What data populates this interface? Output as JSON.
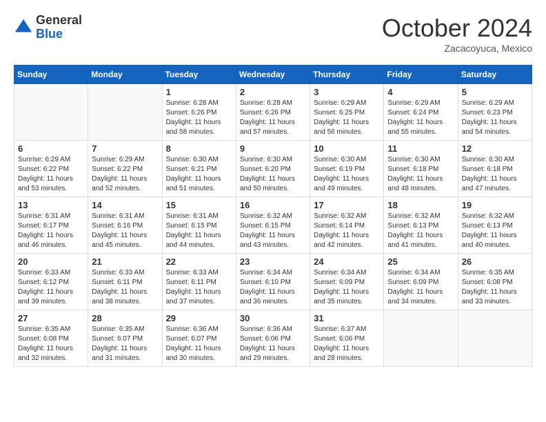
{
  "header": {
    "logo_general": "General",
    "logo_blue": "Blue",
    "month": "October 2024",
    "location": "Zacacoyuca, Mexico"
  },
  "weekdays": [
    "Sunday",
    "Monday",
    "Tuesday",
    "Wednesday",
    "Thursday",
    "Friday",
    "Saturday"
  ],
  "weeks": [
    [
      {
        "day": "",
        "sunrise": "",
        "sunset": "",
        "daylight": ""
      },
      {
        "day": "",
        "sunrise": "",
        "sunset": "",
        "daylight": ""
      },
      {
        "day": "1",
        "sunrise": "Sunrise: 6:28 AM",
        "sunset": "Sunset: 6:26 PM",
        "daylight": "Daylight: 11 hours and 58 minutes."
      },
      {
        "day": "2",
        "sunrise": "Sunrise: 6:28 AM",
        "sunset": "Sunset: 6:26 PM",
        "daylight": "Daylight: 11 hours and 57 minutes."
      },
      {
        "day": "3",
        "sunrise": "Sunrise: 6:29 AM",
        "sunset": "Sunset: 6:25 PM",
        "daylight": "Daylight: 11 hours and 56 minutes."
      },
      {
        "day": "4",
        "sunrise": "Sunrise: 6:29 AM",
        "sunset": "Sunset: 6:24 PM",
        "daylight": "Daylight: 11 hours and 55 minutes."
      },
      {
        "day": "5",
        "sunrise": "Sunrise: 6:29 AM",
        "sunset": "Sunset: 6:23 PM",
        "daylight": "Daylight: 11 hours and 54 minutes."
      }
    ],
    [
      {
        "day": "6",
        "sunrise": "Sunrise: 6:29 AM",
        "sunset": "Sunset: 6:22 PM",
        "daylight": "Daylight: 11 hours and 53 minutes."
      },
      {
        "day": "7",
        "sunrise": "Sunrise: 6:29 AM",
        "sunset": "Sunset: 6:22 PM",
        "daylight": "Daylight: 11 hours and 52 minutes."
      },
      {
        "day": "8",
        "sunrise": "Sunrise: 6:30 AM",
        "sunset": "Sunset: 6:21 PM",
        "daylight": "Daylight: 11 hours and 51 minutes."
      },
      {
        "day": "9",
        "sunrise": "Sunrise: 6:30 AM",
        "sunset": "Sunset: 6:20 PM",
        "daylight": "Daylight: 11 hours and 50 minutes."
      },
      {
        "day": "10",
        "sunrise": "Sunrise: 6:30 AM",
        "sunset": "Sunset: 6:19 PM",
        "daylight": "Daylight: 11 hours and 49 minutes."
      },
      {
        "day": "11",
        "sunrise": "Sunrise: 6:30 AM",
        "sunset": "Sunset: 6:18 PM",
        "daylight": "Daylight: 11 hours and 48 minutes."
      },
      {
        "day": "12",
        "sunrise": "Sunrise: 6:30 AM",
        "sunset": "Sunset: 6:18 PM",
        "daylight": "Daylight: 11 hours and 47 minutes."
      }
    ],
    [
      {
        "day": "13",
        "sunrise": "Sunrise: 6:31 AM",
        "sunset": "Sunset: 6:17 PM",
        "daylight": "Daylight: 11 hours and 46 minutes."
      },
      {
        "day": "14",
        "sunrise": "Sunrise: 6:31 AM",
        "sunset": "Sunset: 6:16 PM",
        "daylight": "Daylight: 11 hours and 45 minutes."
      },
      {
        "day": "15",
        "sunrise": "Sunrise: 6:31 AM",
        "sunset": "Sunset: 6:15 PM",
        "daylight": "Daylight: 11 hours and 44 minutes."
      },
      {
        "day": "16",
        "sunrise": "Sunrise: 6:32 AM",
        "sunset": "Sunset: 6:15 PM",
        "daylight": "Daylight: 11 hours and 43 minutes."
      },
      {
        "day": "17",
        "sunrise": "Sunrise: 6:32 AM",
        "sunset": "Sunset: 6:14 PM",
        "daylight": "Daylight: 11 hours and 42 minutes."
      },
      {
        "day": "18",
        "sunrise": "Sunrise: 6:32 AM",
        "sunset": "Sunset: 6:13 PM",
        "daylight": "Daylight: 11 hours and 41 minutes."
      },
      {
        "day": "19",
        "sunrise": "Sunrise: 6:32 AM",
        "sunset": "Sunset: 6:13 PM",
        "daylight": "Daylight: 11 hours and 40 minutes."
      }
    ],
    [
      {
        "day": "20",
        "sunrise": "Sunrise: 6:33 AM",
        "sunset": "Sunset: 6:12 PM",
        "daylight": "Daylight: 11 hours and 39 minutes."
      },
      {
        "day": "21",
        "sunrise": "Sunrise: 6:33 AM",
        "sunset": "Sunset: 6:11 PM",
        "daylight": "Daylight: 11 hours and 38 minutes."
      },
      {
        "day": "22",
        "sunrise": "Sunrise: 6:33 AM",
        "sunset": "Sunset: 6:11 PM",
        "daylight": "Daylight: 11 hours and 37 minutes."
      },
      {
        "day": "23",
        "sunrise": "Sunrise: 6:34 AM",
        "sunset": "Sunset: 6:10 PM",
        "daylight": "Daylight: 11 hours and 36 minutes."
      },
      {
        "day": "24",
        "sunrise": "Sunrise: 6:34 AM",
        "sunset": "Sunset: 6:09 PM",
        "daylight": "Daylight: 11 hours and 35 minutes."
      },
      {
        "day": "25",
        "sunrise": "Sunrise: 6:34 AM",
        "sunset": "Sunset: 6:09 PM",
        "daylight": "Daylight: 11 hours and 34 minutes."
      },
      {
        "day": "26",
        "sunrise": "Sunrise: 6:35 AM",
        "sunset": "Sunset: 6:08 PM",
        "daylight": "Daylight: 11 hours and 33 minutes."
      }
    ],
    [
      {
        "day": "27",
        "sunrise": "Sunrise: 6:35 AM",
        "sunset": "Sunset: 6:08 PM",
        "daylight": "Daylight: 11 hours and 32 minutes."
      },
      {
        "day": "28",
        "sunrise": "Sunrise: 6:35 AM",
        "sunset": "Sunset: 6:07 PM",
        "daylight": "Daylight: 11 hours and 31 minutes."
      },
      {
        "day": "29",
        "sunrise": "Sunrise: 6:36 AM",
        "sunset": "Sunset: 6:07 PM",
        "daylight": "Daylight: 11 hours and 30 minutes."
      },
      {
        "day": "30",
        "sunrise": "Sunrise: 6:36 AM",
        "sunset": "Sunset: 6:06 PM",
        "daylight": "Daylight: 11 hours and 29 minutes."
      },
      {
        "day": "31",
        "sunrise": "Sunrise: 6:37 AM",
        "sunset": "Sunset: 6:06 PM",
        "daylight": "Daylight: 11 hours and 28 minutes."
      },
      {
        "day": "",
        "sunrise": "",
        "sunset": "",
        "daylight": ""
      },
      {
        "day": "",
        "sunrise": "",
        "sunset": "",
        "daylight": ""
      }
    ]
  ]
}
